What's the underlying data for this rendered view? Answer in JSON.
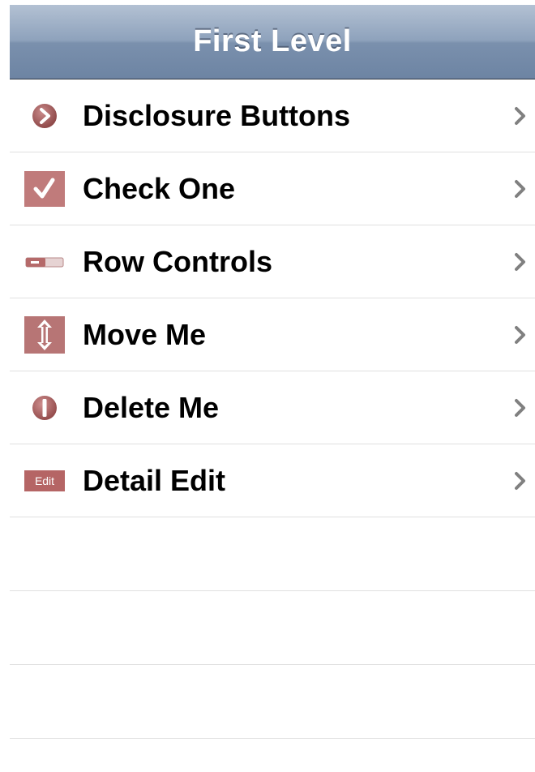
{
  "navbar": {
    "title": "First Level"
  },
  "list": {
    "items": [
      {
        "label": "Disclosure Buttons",
        "icon": "disclosure-icon"
      },
      {
        "label": "Check One",
        "icon": "checkmark-icon"
      },
      {
        "label": "Row Controls",
        "icon": "switch-icon"
      },
      {
        "label": "Move Me",
        "icon": "move-arrows-icon"
      },
      {
        "label": "Delete Me",
        "icon": "delete-icon"
      },
      {
        "label": "Detail Edit",
        "icon": "edit-icon",
        "icon_text": "Edit"
      }
    ]
  },
  "colors": {
    "icon_accent": "#b06a6a",
    "navbar_top": "#b3c1d3",
    "navbar_bottom": "#6d84a3",
    "chevron": "#808080",
    "separator": "#e0e0e0"
  }
}
